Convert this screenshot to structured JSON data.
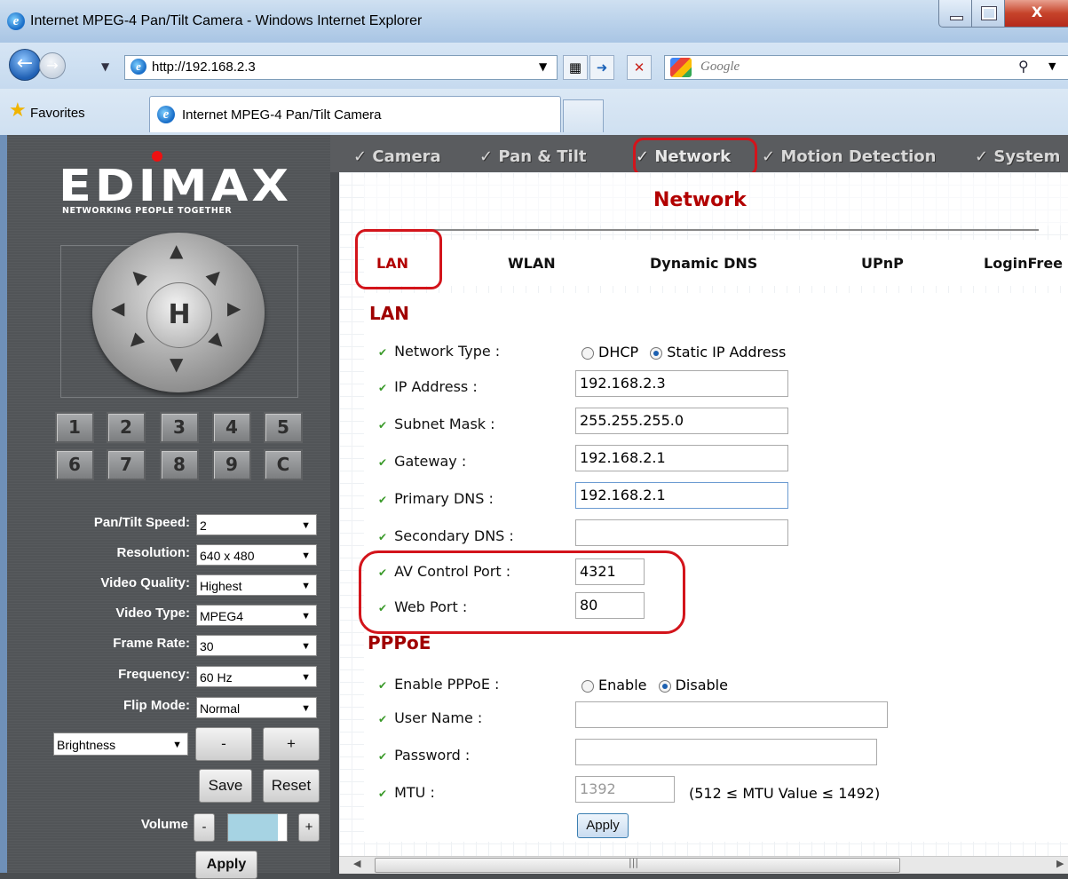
{
  "window": {
    "title": "Internet MPEG-4 Pan/Tilt Camera - Windows Internet Explorer",
    "minimize": "–",
    "maximize": "□",
    "close": "X"
  },
  "browser": {
    "url": "http://192.168.2.3",
    "search_placeholder": "Google",
    "favorites_label": "Favorites",
    "tab_title": "Internet MPEG-4 Pan/Tilt Camera"
  },
  "sidebar": {
    "logo": "EDIMAX",
    "tagline": "NETWORKING PEOPLE TOGETHER",
    "ptz_home": "H",
    "presets": [
      "1",
      "2",
      "3",
      "4",
      "5",
      "6",
      "7",
      "8",
      "9",
      "C"
    ],
    "settings": [
      {
        "label": "Pan/Tilt Speed:",
        "value": "2"
      },
      {
        "label": "Resolution:",
        "value": "640 x 480"
      },
      {
        "label": "Video Quality:",
        "value": "Highest"
      },
      {
        "label": "Video Type:",
        "value": "MPEG4"
      },
      {
        "label": "Frame Rate:",
        "value": "30"
      },
      {
        "label": "Frequency:",
        "value": "60 Hz"
      },
      {
        "label": "Flip Mode:",
        "value": "Normal"
      }
    ],
    "brightness_select": "Brightness",
    "minus": "-",
    "plus": "+",
    "save": "Save",
    "reset": "Reset",
    "volume_label": "Volume",
    "apply": "Apply"
  },
  "topnav": [
    "Camera",
    "Pan & Tilt",
    "Network",
    "Motion Detection",
    "System"
  ],
  "page": {
    "title": "Network",
    "subtabs": [
      "LAN",
      "WLAN",
      "Dynamic DNS",
      "UPnP",
      "LoginFree"
    ]
  },
  "lan": {
    "heading": "LAN",
    "network_type_label": "Network Type :",
    "dhcp": "DHCP",
    "static": "Static IP Address",
    "selected": "Static IP Address",
    "ip_label": "IP Address :",
    "ip": "192.168.2.3",
    "subnet_label": "Subnet Mask :",
    "subnet": "255.255.255.0",
    "gateway_label": "Gateway :",
    "gateway": "192.168.2.1",
    "dns1_label": "Primary DNS :",
    "dns1": "192.168.2.1",
    "dns2_label": "Secondary DNS :",
    "dns2": "",
    "av_label": "AV Control Port :",
    "av": "4321",
    "web_label": "Web Port :",
    "web": "80"
  },
  "pppoe": {
    "heading": "PPPoE",
    "enable_label": "Enable PPPoE :",
    "enable": "Enable",
    "disable": "Disable",
    "selected": "Disable",
    "user_label": "User Name :",
    "user": "",
    "pass_label": "Password :",
    "pass": "",
    "mtu_label": "MTU :",
    "mtu": "1392",
    "mtu_hint": "(512 ≤ MTU Value ≤ 1492)",
    "apply": "Apply"
  },
  "colors": {
    "accent_red": "#d3141b",
    "heading_red": "#a00000",
    "check_green": "#3a9a2a"
  }
}
